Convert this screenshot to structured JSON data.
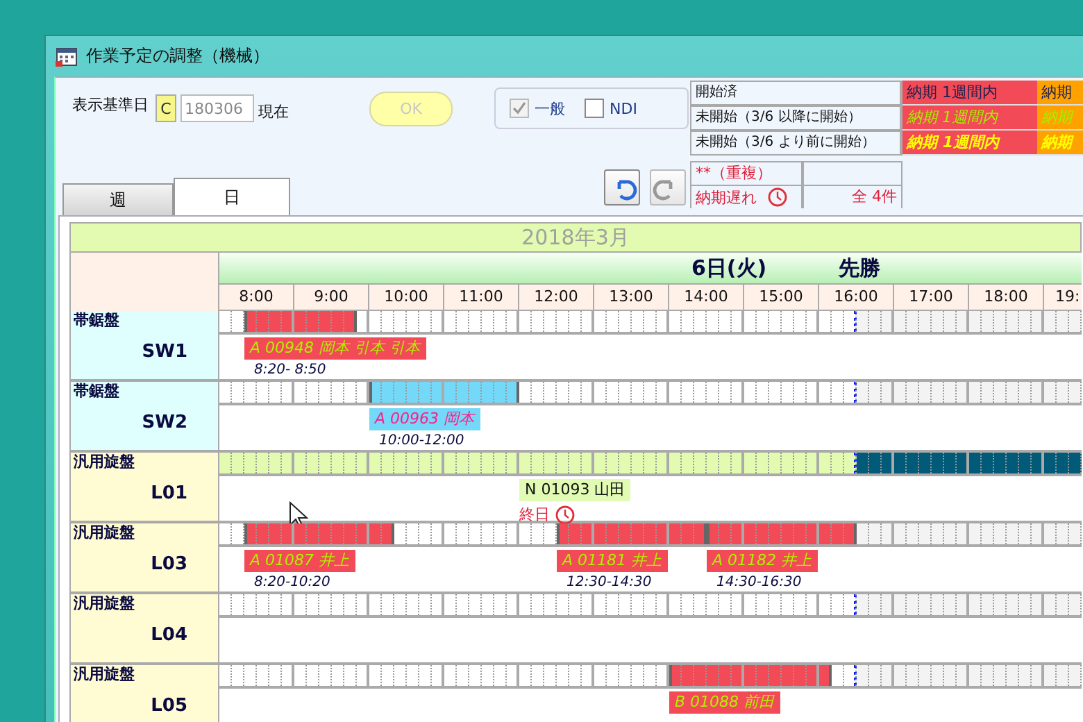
{
  "window": {
    "title": "作業予定の調整（機械）"
  },
  "base_date": {
    "label": "表示基準日",
    "c_button": "C",
    "value": "180306",
    "suffix": "現在"
  },
  "ok_button": {
    "label": "OK",
    "disabled": true
  },
  "filters": [
    {
      "label": "一般",
      "checked": true,
      "disabled": true
    },
    {
      "label": "NDI",
      "checked": false,
      "disabled": false
    }
  ],
  "legend": {
    "rows": [
      {
        "label": "開始済",
        "kind": "started",
        "cells": [
          {
            "text": "納期 1週間内",
            "color": "#f24a56"
          },
          {
            "text": "納期",
            "color": "#ffa200"
          }
        ]
      },
      {
        "label": "未開始（3/6 以降に開始）",
        "kind": "upcoming",
        "cells": [
          {
            "text": "納期 1週間内",
            "color": "#f24a56"
          },
          {
            "text": "納期",
            "color": "#ffa200"
          }
        ]
      },
      {
        "label": "未開始（3/6 より前に開始）",
        "kind": "overdue",
        "cells": [
          {
            "text": "納期 1週間内",
            "color": "#f24a56"
          },
          {
            "text": "納期",
            "color": "#ffa200"
          }
        ]
      }
    ],
    "duplicate": "**（重複）",
    "late": {
      "label": "納期遅れ",
      "count": "全 4件"
    }
  },
  "tabs": [
    {
      "label": "週",
      "selected": false
    },
    {
      "label": "日",
      "selected": true
    }
  ],
  "history_buttons": [
    {
      "kind": "undo",
      "disabled": false
    },
    {
      "kind": "redo",
      "disabled": true
    }
  ],
  "schedule": {
    "month": "2018年3月",
    "day": "6日(火)",
    "rokuyo": "先勝",
    "hours": [
      "8:00",
      "9:00",
      "10:00",
      "11:00",
      "12:00",
      "13:00",
      "14:00",
      "15:00",
      "16:00",
      "17:00",
      "18:00",
      "19:"
    ]
  },
  "machines": [
    {
      "group": "帯鋸盤",
      "code": "SW1",
      "kind": "saw",
      "highlighted": false,
      "level": 0.7391,
      "color": "#f24a56",
      "slots": [
        {
          "busy": false
        },
        {
          "busy": false
        },
        {
          "busy": true,
          "job": {
            "label": "A 00948 岡本 引本 引本",
            "color": "#f24a56",
            "kind": "started",
            "time": "8:20- 8:50"
          }
        },
        {
          "busy": true
        },
        {
          "busy": true
        },
        {
          "busy": true
        },
        {
          "busy": true
        },
        {
          "busy": true
        },
        {
          "busy": true
        },
        {
          "busy": true
        },
        {
          "busy": true
        },
        {
          "busy": false
        },
        {
          "busy": false
        },
        {
          "busy": false
        },
        {
          "busy": false
        },
        {
          "busy": false
        },
        {
          "busy": false
        },
        {
          "busy": false
        },
        {
          "busy": false
        },
        {
          "busy": false
        },
        {
          "busy": false
        },
        {
          "busy": false
        },
        {
          "busy": false
        },
        {
          "busy": false
        },
        {
          "busy": false
        },
        {
          "busy": false
        },
        {
          "busy": false
        },
        {
          "busy": false
        },
        {
          "busy": false
        },
        {
          "busy": false
        },
        {
          "busy": false
        },
        {
          "busy": false
        },
        {
          "busy": false
        },
        {
          "busy": false
        },
        {
          "busy": false
        },
        {
          "busy": false
        },
        {
          "busy": false
        },
        {
          "busy": false
        },
        {
          "busy": false
        },
        {
          "busy": false
        },
        {
          "busy": false
        },
        {
          "busy": false
        },
        {
          "busy": false
        },
        {
          "busy": false
        },
        {
          "busy": false
        },
        {
          "busy": false
        },
        {
          "busy": false
        },
        {
          "busy": false
        },
        {
          "busy": false
        },
        {
          "busy": false
        },
        {
          "busy": false
        },
        {
          "busy": false
        },
        {
          "busy": false
        },
        {
          "busy": false
        },
        {
          "busy": false
        },
        {
          "busy": false
        },
        {
          "busy": false
        },
        {
          "busy": false
        },
        {
          "busy": false
        },
        {
          "busy": false
        },
        {
          "busy": false
        },
        {
          "busy": false
        },
        {
          "busy": false
        },
        {
          "busy": false
        },
        {
          "busy": false
        },
        {
          "busy": false
        },
        {
          "busy": false
        },
        {
          "busy": false
        },
        {
          "busy": false
        }
      ]
    },
    {
      "group": "帯鋸盤",
      "code": "SW2",
      "kind": "saw",
      "highlighted": false,
      "level": 0.7391,
      "color": "#74d8f8",
      "slots": [
        {
          "busy": false
        },
        {
          "busy": false
        },
        {
          "busy": false
        },
        {
          "busy": false
        },
        {
          "busy": false
        },
        {
          "busy": false
        },
        {
          "busy": false
        },
        {
          "busy": false
        },
        {
          "busy": false
        },
        {
          "busy": false
        },
        {
          "busy": false
        },
        {
          "busy": false
        },
        {
          "busy": true,
          "job": {
            "label": "A 00963 岡本",
            "color": "#74d8f8",
            "kind": "reserved",
            "time": "10:00-12:00"
          }
        },
        {
          "busy": true
        },
        {
          "busy": true
        },
        {
          "busy": true
        },
        {
          "busy": true
        },
        {
          "busy": true
        },
        {
          "busy": true
        },
        {
          "busy": true
        },
        {
          "busy": true
        },
        {
          "busy": true
        },
        {
          "busy": true
        },
        {
          "busy": true
        },
        {
          "busy": false
        },
        {
          "busy": false
        },
        {
          "busy": false
        },
        {
          "busy": false
        },
        {
          "busy": false
        },
        {
          "busy": false
        },
        {
          "busy": false
        },
        {
          "busy": false
        },
        {
          "busy": false
        },
        {
          "busy": false
        },
        {
          "busy": false
        },
        {
          "busy": false
        },
        {
          "busy": false
        },
        {
          "busy": false
        },
        {
          "busy": false
        },
        {
          "busy": false
        },
        {
          "busy": false
        },
        {
          "busy": false
        },
        {
          "busy": false
        },
        {
          "busy": false
        },
        {
          "busy": false
        },
        {
          "busy": false
        },
        {
          "busy": false
        },
        {
          "busy": false
        },
        {
          "busy": false
        },
        {
          "busy": false
        },
        {
          "busy": false
        },
        {
          "busy": false
        },
        {
          "busy": false
        },
        {
          "busy": false
        },
        {
          "busy": false
        },
        {
          "busy": false
        },
        {
          "busy": false
        },
        {
          "busy": false
        },
        {
          "busy": false
        },
        {
          "busy": false
        },
        {
          "busy": false
        },
        {
          "busy": false
        },
        {
          "busy": false
        },
        {
          "busy": false
        },
        {
          "busy": false
        },
        {
          "busy": false
        },
        {
          "busy": false
        },
        {
          "busy": false
        },
        {
          "busy": false
        }
      ]
    },
    {
      "group": "汎用旋盤",
      "code": "L01",
      "kind": "lathe",
      "highlighted": true,
      "level": 0.7391,
      "slots": [
        {
          "busy": false
        },
        {
          "busy": false
        },
        {
          "busy": false
        },
        {
          "busy": false
        },
        {
          "busy": false
        },
        {
          "busy": false
        },
        {
          "busy": false
        },
        {
          "busy": false
        },
        {
          "busy": false
        },
        {
          "busy": false
        },
        {
          "busy": false
        },
        {
          "busy": false
        },
        {
          "busy": false
        },
        {
          "busy": false
        },
        {
          "busy": false
        },
        {
          "busy": false
        },
        {
          "busy": false
        },
        {
          "busy": false
        },
        {
          "busy": false
        },
        {
          "busy": false
        },
        {
          "busy": false
        },
        {
          "busy": false
        },
        {
          "busy": false
        },
        {
          "busy": false
        },
        {
          "busy": false,
          "job": {
            "label": "N 01093 山田",
            "color": "#e2fbb4",
            "kind": "all_day",
            "time": "終日",
            "late": true
          }
        },
        {
          "busy": false
        },
        {
          "busy": false
        },
        {
          "busy": false
        },
        {
          "busy": false
        },
        {
          "busy": false
        },
        {
          "busy": false
        },
        {
          "busy": false
        },
        {
          "busy": false
        },
        {
          "busy": false
        },
        {
          "busy": false
        },
        {
          "busy": false
        },
        {
          "busy": false
        },
        {
          "busy": false
        },
        {
          "busy": false
        },
        {
          "busy": false
        },
        {
          "busy": false
        },
        {
          "busy": false
        },
        {
          "busy": false
        },
        {
          "busy": false
        },
        {
          "busy": false
        },
        {
          "busy": false
        },
        {
          "busy": false
        },
        {
          "busy": false
        },
        {
          "busy": false
        },
        {
          "busy": false
        },
        {
          "busy": false
        },
        {
          "busy": false
        },
        {
          "busy": false
        },
        {
          "busy": false
        },
        {
          "busy": false
        },
        {
          "busy": false
        },
        {
          "busy": false
        },
        {
          "busy": false
        },
        {
          "busy": false
        },
        {
          "busy": false
        },
        {
          "busy": false
        },
        {
          "busy": false
        },
        {
          "busy": false
        },
        {
          "busy": false
        },
        {
          "busy": false
        },
        {
          "busy": false
        },
        {
          "busy": false
        },
        {
          "busy": false
        },
        {
          "busy": false
        }
      ]
    },
    {
      "group": "汎用旋盤",
      "code": "L03",
      "kind": "lathe",
      "highlighted": false,
      "level": 0.7391,
      "color": "#f24a56",
      "slots": [
        {
          "busy": false
        },
        {
          "busy": false
        },
        {
          "busy": true,
          "job": {
            "label": "A 01087 井上",
            "color": "#f24a56",
            "kind": "started",
            "time": "8:20-10:20"
          }
        },
        {
          "busy": true
        },
        {
          "busy": true
        },
        {
          "busy": true
        },
        {
          "busy": true
        },
        {
          "busy": true
        },
        {
          "busy": true
        },
        {
          "busy": true
        },
        {
          "busy": true
        },
        {
          "busy": true
        },
        {
          "busy": true
        },
        {
          "busy": true
        },
        {
          "busy": false
        },
        {
          "busy": false
        },
        {
          "busy": false
        },
        {
          "busy": false
        },
        {
          "busy": false
        },
        {
          "busy": false
        },
        {
          "busy": false
        },
        {
          "busy": false
        },
        {
          "busy": false
        },
        {
          "busy": false
        },
        {
          "busy": false
        },
        {
          "busy": false
        },
        {
          "busy": false
        },
        {
          "busy": true,
          "job": {
            "label": "A 01181 井上",
            "color": "#f24a56",
            "kind": "started",
            "time": "12:30-14:30"
          }
        },
        {
          "busy": true
        },
        {
          "busy": true
        },
        {
          "busy": true
        },
        {
          "busy": true
        },
        {
          "busy": true
        },
        {
          "busy": true
        },
        {
          "busy": true
        },
        {
          "busy": true
        },
        {
          "busy": true
        },
        {
          "busy": true
        },
        {
          "busy": true
        },
        {
          "busy": true,
          "job": {
            "label": "A 01182 井上",
            "color": "#f24a56",
            "kind": "started",
            "time": "14:30-16:30"
          }
        },
        {
          "busy": true
        },
        {
          "busy": true
        },
        {
          "busy": true
        },
        {
          "busy": true
        },
        {
          "busy": true
        },
        {
          "busy": true
        },
        {
          "busy": true
        },
        {
          "busy": true
        },
        {
          "busy": true
        },
        {
          "busy": true
        },
        {
          "busy": true
        },
        {
          "busy": false
        },
        {
          "busy": false
        },
        {
          "busy": false
        },
        {
          "busy": false
        },
        {
          "busy": false
        },
        {
          "busy": false
        },
        {
          "busy": false
        },
        {
          "busy": false
        },
        {
          "busy": false
        },
        {
          "busy": false
        },
        {
          "busy": false
        },
        {
          "busy": false
        },
        {
          "busy": false
        },
        {
          "busy": false
        },
        {
          "busy": false
        },
        {
          "busy": false
        },
        {
          "busy": false
        },
        {
          "busy": false
        }
      ]
    },
    {
      "group": "汎用旋盤",
      "code": "L04",
      "kind": "lathe",
      "highlighted": false,
      "level": 0.7391,
      "slots": [
        {
          "busy": false
        },
        {
          "busy": false
        },
        {
          "busy": false
        },
        {
          "busy": false
        },
        {
          "busy": false
        },
        {
          "busy": false
        },
        {
          "busy": false
        },
        {
          "busy": false
        },
        {
          "busy": false
        },
        {
          "busy": false
        },
        {
          "busy": false
        },
        {
          "busy": false
        },
        {
          "busy": false
        },
        {
          "busy": false
        },
        {
          "busy": false
        },
        {
          "busy": false
        },
        {
          "busy": false
        },
        {
          "busy": false
        },
        {
          "busy": false
        },
        {
          "busy": false
        },
        {
          "busy": false
        },
        {
          "busy": false
        },
        {
          "busy": false
        },
        {
          "busy": false
        },
        {
          "busy": false
        },
        {
          "busy": false
        },
        {
          "busy": false
        },
        {
          "busy": false
        },
        {
          "busy": false
        },
        {
          "busy": false
        },
        {
          "busy": false
        },
        {
          "busy": false
        },
        {
          "busy": false
        },
        {
          "busy": false
        },
        {
          "busy": false
        },
        {
          "busy": false
        },
        {
          "busy": false
        },
        {
          "busy": false
        },
        {
          "busy": false
        },
        {
          "busy": false
        },
        {
          "busy": false
        },
        {
          "busy": false
        },
        {
          "busy": false
        },
        {
          "busy": false
        },
        {
          "busy": false
        },
        {
          "busy": false
        },
        {
          "busy": false
        },
        {
          "busy": false
        },
        {
          "busy": false
        },
        {
          "busy": false
        },
        {
          "busy": false
        },
        {
          "busy": false
        },
        {
          "busy": false
        },
        {
          "busy": false
        },
        {
          "busy": false
        },
        {
          "busy": false
        },
        {
          "busy": false
        },
        {
          "busy": false
        },
        {
          "busy": false
        },
        {
          "busy": false
        },
        {
          "busy": false
        },
        {
          "busy": false
        },
        {
          "busy": false
        },
        {
          "busy": false
        },
        {
          "busy": false
        },
        {
          "busy": false
        },
        {
          "busy": false
        },
        {
          "busy": false
        },
        {
          "busy": false
        }
      ]
    },
    {
      "group": "汎用旋盤",
      "code": "L05",
      "kind": "lathe",
      "highlighted": false,
      "level": 0.7391,
      "color": "#f24a56",
      "slots": [
        {
          "busy": false
        },
        {
          "busy": false
        },
        {
          "busy": false
        },
        {
          "busy": false
        },
        {
          "busy": false
        },
        {
          "busy": false
        },
        {
          "busy": false
        },
        {
          "busy": false
        },
        {
          "busy": false
        },
        {
          "busy": false
        },
        {
          "busy": false
        },
        {
          "busy": false
        },
        {
          "busy": false
        },
        {
          "busy": false
        },
        {
          "busy": false
        },
        {
          "busy": false
        },
        {
          "busy": false
        },
        {
          "busy": false
        },
        {
          "busy": false
        },
        {
          "busy": false
        },
        {
          "busy": false
        },
        {
          "busy": false
        },
        {
          "busy": false
        },
        {
          "busy": false
        },
        {
          "busy": false
        },
        {
          "busy": false
        },
        {
          "busy": false
        },
        {
          "busy": false
        },
        {
          "busy": false
        },
        {
          "busy": false
        },
        {
          "busy": false
        },
        {
          "busy": false
        },
        {
          "busy": false
        },
        {
          "busy": false
        },
        {
          "busy": false
        },
        {
          "busy": false
        },
        {
          "busy": true,
          "job": {
            "label": "B 01088 前田",
            "color": "#f24a56",
            "kind": "started"
          }
        },
        {
          "busy": true
        },
        {
          "busy": true
        },
        {
          "busy": true
        },
        {
          "busy": true
        },
        {
          "busy": true
        },
        {
          "busy": true
        },
        {
          "busy": true
        },
        {
          "busy": true
        },
        {
          "busy": true
        },
        {
          "busy": true
        },
        {
          "busy": true
        },
        {
          "busy": true
        },
        {
          "busy": false
        },
        {
          "busy": false
        },
        {
          "busy": false
        },
        {
          "busy": false
        },
        {
          "busy": false
        },
        {
          "busy": false
        },
        {
          "busy": false
        },
        {
          "busy": false
        },
        {
          "busy": false
        },
        {
          "busy": false
        },
        {
          "busy": false
        },
        {
          "busy": false
        },
        {
          "busy": false
        },
        {
          "busy": false
        },
        {
          "busy": false
        },
        {
          "busy": false
        },
        {
          "busy": false
        },
        {
          "busy": false
        },
        {
          "busy": false
        },
        {
          "busy": false
        }
      ]
    }
  ]
}
